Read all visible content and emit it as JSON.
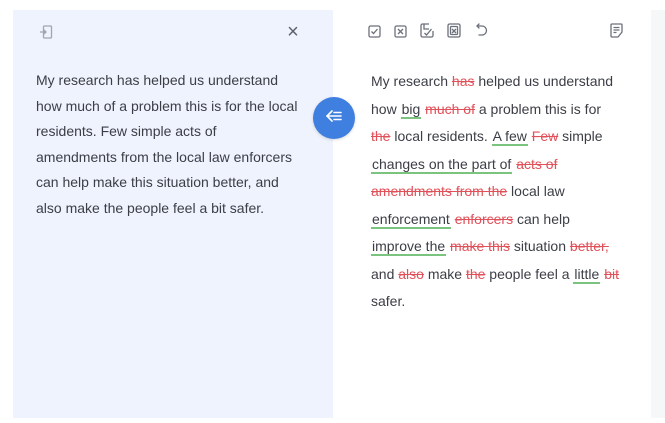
{
  "left": {
    "paragraph": "My research has helped us understand how much of a problem this is for the local residents. Few simple acts of amendments from the local law enforcers can help make this situation better, and also make the people feel a bit safer.",
    "close_label": "×"
  },
  "right": {
    "tokens": [
      {
        "t": "My research ",
        "k": "n"
      },
      {
        "t": "has",
        "k": "d"
      },
      {
        "t": " helped us understand how ",
        "k": "n"
      },
      {
        "t": "big",
        "k": "i"
      },
      {
        "t": " ",
        "k": "n"
      },
      {
        "t": "much of",
        "k": "d"
      },
      {
        "t": " a problem this is for ",
        "k": "n"
      },
      {
        "t": "the",
        "k": "d"
      },
      {
        "t": " local residents. ",
        "k": "n"
      },
      {
        "t": "A few",
        "k": "i"
      },
      {
        "t": " ",
        "k": "n"
      },
      {
        "t": "Few",
        "k": "d"
      },
      {
        "t": " simple ",
        "k": "n"
      },
      {
        "t": "changes on the part of",
        "k": "i"
      },
      {
        "t": " ",
        "k": "n"
      },
      {
        "t": "acts of amendments from the",
        "k": "d"
      },
      {
        "t": " local law ",
        "k": "n"
      },
      {
        "t": "enforcement",
        "k": "i"
      },
      {
        "t": " ",
        "k": "n"
      },
      {
        "t": "enforcers",
        "k": "d"
      },
      {
        "t": " can help ",
        "k": "n"
      },
      {
        "t": "improve the",
        "k": "i"
      },
      {
        "t": " ",
        "k": "n"
      },
      {
        "t": "make this",
        "k": "d"
      },
      {
        "t": " situation ",
        "k": "n"
      },
      {
        "t": "better,",
        "k": "d"
      },
      {
        "t": " and ",
        "k": "n"
      },
      {
        "t": "also",
        "k": "d"
      },
      {
        "t": " make ",
        "k": "n"
      },
      {
        "t": "the",
        "k": "d"
      },
      {
        "t": " people feel a ",
        "k": "n"
      },
      {
        "t": "little",
        "k": "i"
      },
      {
        "t": " ",
        "k": "n"
      },
      {
        "t": "bit",
        "k": "d"
      },
      {
        "t": " safer.",
        "k": "n"
      }
    ]
  },
  "colors": {
    "insert_underline": "#7bc47f",
    "delete_text": "#e0515a",
    "accent_button": "#3f7fe0",
    "left_panel_bg": "#eff3fd"
  },
  "icons": {
    "left_top": "import-icon",
    "close": "close-icon",
    "accept": "accept-checkbox-icon",
    "reject": "reject-checkbox-icon",
    "accept_all": "accept-all-icon",
    "reject_all": "reject-all-icon",
    "undo": "undo-icon",
    "notes": "notes-icon",
    "swap": "arrow-left-icon"
  }
}
